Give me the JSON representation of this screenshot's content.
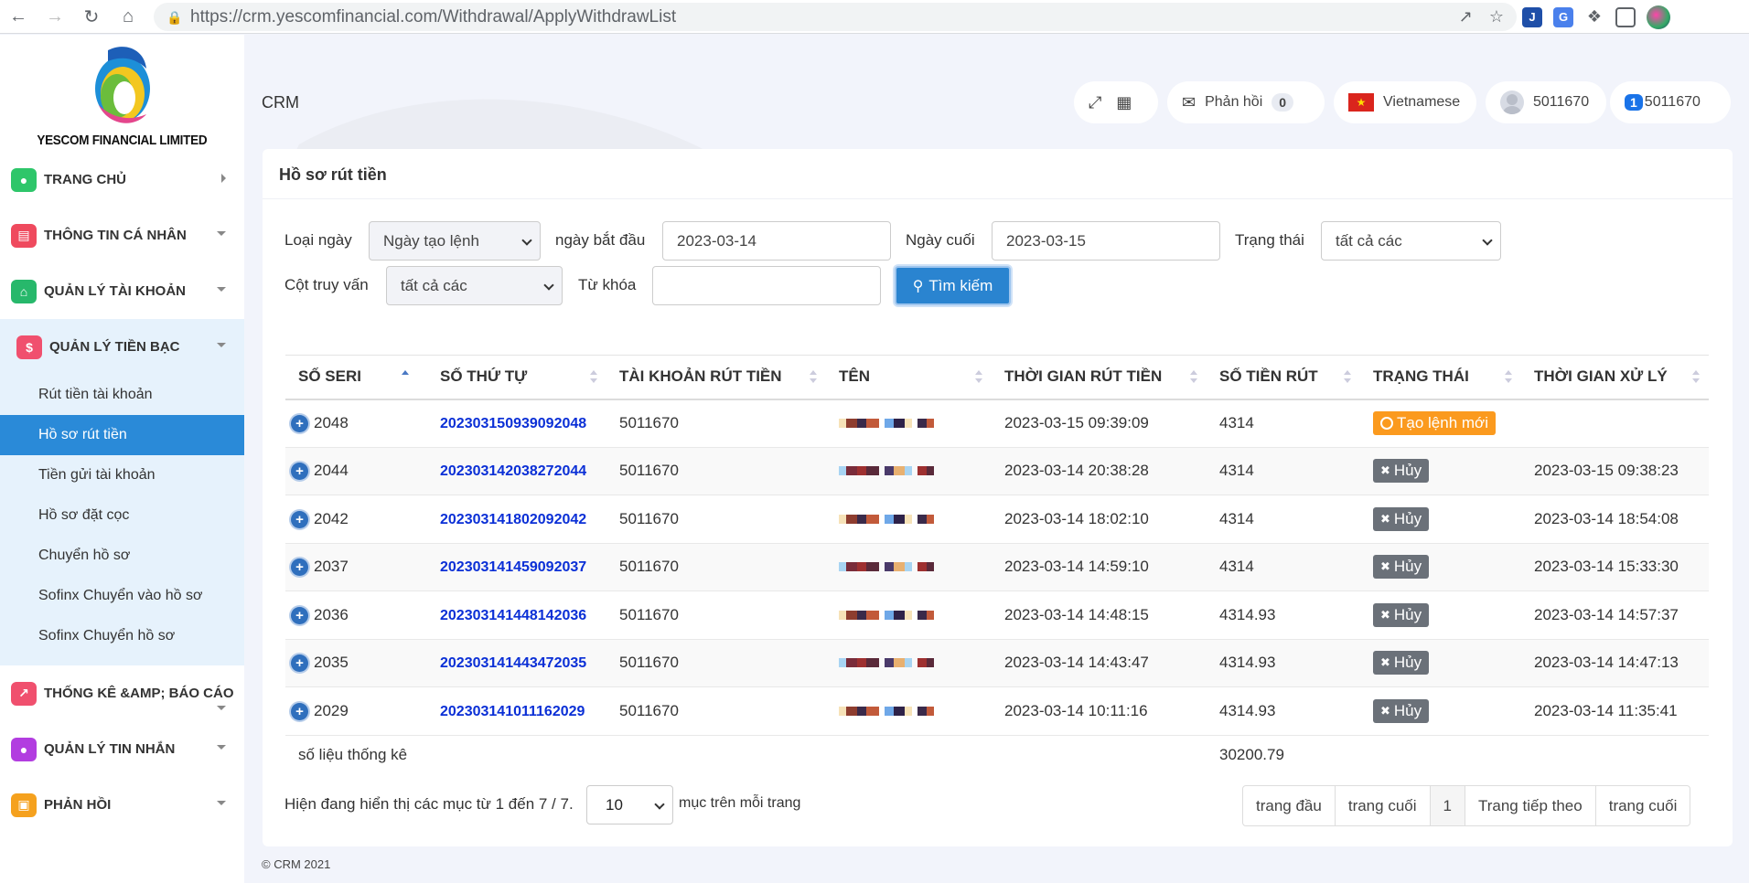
{
  "browser": {
    "url": "https://crm.yescomfinancial.com/Withdrawal/ApplyWithdrawList"
  },
  "sidebar": {
    "logo_text": "YESCOM FINANCIAL LIMITED",
    "items": [
      {
        "label": "TRANG CHỦ",
        "icon": "user-icon",
        "color": "#2ec66a"
      },
      {
        "label": "THÔNG TIN CÁ NHÂN",
        "icon": "id-card-icon",
        "color": "#ef4a5e"
      },
      {
        "label": "QUẢN LÝ TÀI KHOẢN",
        "icon": "bank-icon",
        "color": "#27b86b"
      },
      {
        "label": "QUẢN LÝ TIỀN BẠC",
        "icon": "dollar-icon",
        "color": "#f0506e"
      },
      {
        "label": "THỐNG KÊ &AMP; BÁO CÁO",
        "icon": "chart-icon",
        "color": "#f0506e"
      },
      {
        "label": "QUẢN LÝ TIN NHẮN",
        "icon": "message-icon",
        "color": "#b23de0"
      },
      {
        "label": "PHẢN HỒI",
        "icon": "inbox-icon",
        "color": "#f5a11e"
      }
    ],
    "submenu": [
      "Rút tiền tài khoản",
      "Hồ sơ rút tiền",
      "Tiền gửi tài khoản",
      "Hồ sơ đặt cọc",
      "Chuyển hồ sơ",
      "Sofinx Chuyển vào hồ sơ",
      "Sofinx Chuyển hồ sơ"
    ]
  },
  "header": {
    "title": "CRM",
    "feedback_label": "Phản hồi",
    "feedback_count": "0",
    "language": "Vietnamese",
    "user_id": "5011670",
    "account_badge": "1",
    "account_id": "5011670"
  },
  "panel": {
    "title": "Hồ sơ rút tiền"
  },
  "filters": {
    "date_type_label": "Loại ngày",
    "date_type_value": "Ngày tạo lệnh",
    "start_label": "ngày bắt đầu",
    "start_value": "2023-03-14",
    "end_label": "Ngày cuối",
    "end_value": "2023-03-15",
    "status_label": "Trạng thái",
    "status_value": "tất cả các",
    "column_label": "Cột truy vấn",
    "column_value": "tất cả các",
    "keyword_label": "Từ khóa",
    "keyword_value": "",
    "search_button": "Tìm kiếm"
  },
  "table": {
    "headers": [
      "SỐ SERI",
      "SỐ THỨ TỰ",
      "TÀI KHOẢN RÚT TIỀN",
      "TÊN",
      "THỜI GIAN RÚT TIỀN",
      "SỐ TIỀN RÚT",
      "TRẠNG THÁI",
      "THỜI GIAN XỬ LÝ"
    ],
    "rows": [
      {
        "seri": "2048",
        "order": "202303150939092048",
        "account": "5011670",
        "time": "2023-03-15 09:39:09",
        "amount": "4314",
        "status": "Tạo lệnh mới",
        "processed": ""
      },
      {
        "seri": "2044",
        "order": "202303142038272044",
        "account": "5011670",
        "time": "2023-03-14 20:38:28",
        "amount": "4314",
        "status": "Hủy",
        "processed": "2023-03-15 09:38:23"
      },
      {
        "seri": "2042",
        "order": "202303141802092042",
        "account": "5011670",
        "time": "2023-03-14 18:02:10",
        "amount": "4314",
        "status": "Hủy",
        "processed": "2023-03-14 18:54:08"
      },
      {
        "seri": "2037",
        "order": "202303141459092037",
        "account": "5011670",
        "time": "2023-03-14 14:59:10",
        "amount": "4314",
        "status": "Hủy",
        "processed": "2023-03-14 15:33:30"
      },
      {
        "seri": "2036",
        "order": "202303141448142036",
        "account": "5011670",
        "time": "2023-03-14 14:48:15",
        "amount": "4314.93",
        "status": "Hủy",
        "processed": "2023-03-14 14:57:37"
      },
      {
        "seri": "2035",
        "order": "202303141443472035",
        "account": "5011670",
        "time": "2023-03-14 14:43:47",
        "amount": "4314.93",
        "status": "Hủy",
        "processed": "2023-03-14 14:47:13"
      },
      {
        "seri": "2029",
        "order": "202303141011162029",
        "account": "5011670",
        "time": "2023-03-14 10:11:16",
        "amount": "4314.93",
        "status": "Hủy",
        "processed": "2023-03-14 11:35:41"
      }
    ],
    "total_label": "số liệu thống kê",
    "total_value": "30200.79"
  },
  "footer": {
    "showing_text": "Hiện đang hiển thị các mục từ 1 đến 7 / 7.",
    "page_size": "10",
    "per_page_text": "mục trên mỗi trang",
    "pager": [
      "trang đầu",
      "trang cuối",
      "1",
      "Trang tiếp theo",
      "trang cuối"
    ],
    "copyright": "© CRM 2021"
  }
}
